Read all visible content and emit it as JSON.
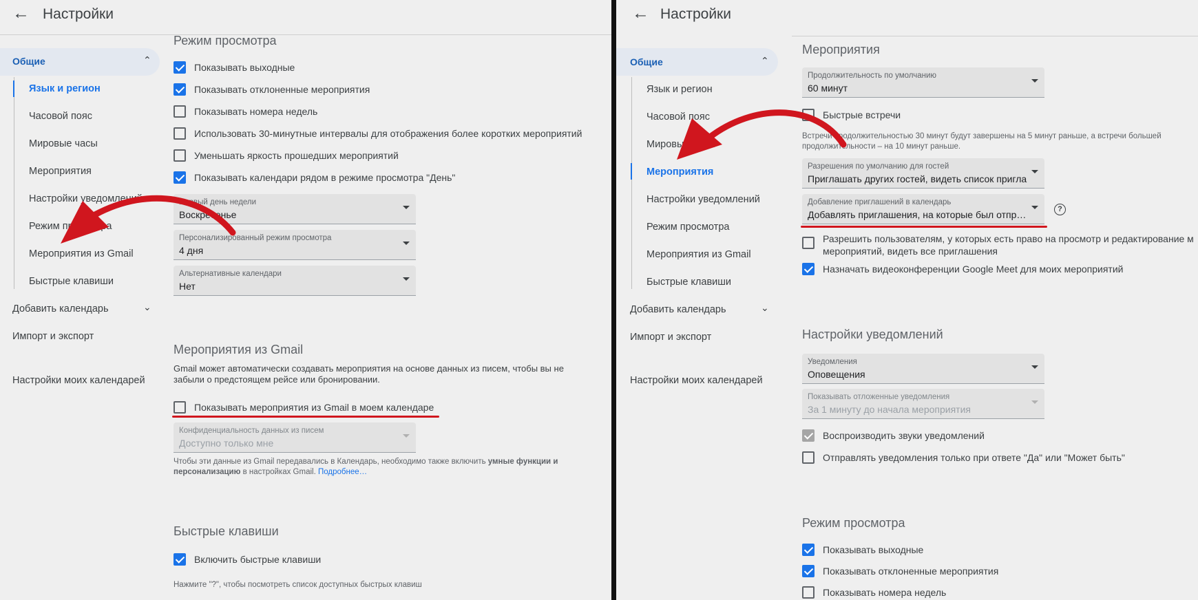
{
  "left": {
    "title": "Настройки",
    "nav": {
      "general": "Общие",
      "items": [
        "Язык и регион",
        "Часовой пояс",
        "Мировые часы",
        "Мероприятия",
        "Настройки уведомлений",
        "Режим просмотра",
        "Мероприятия из Gmail",
        "Быстрые клавиши"
      ],
      "add_calendar": "Добавить календарь",
      "import_export": "Импорт и экспорт",
      "my_calendars": "Настройки моих календарей"
    },
    "view": {
      "title": "Режим просмотра",
      "checks": [
        {
          "label": "Показывать выходные",
          "checked": true
        },
        {
          "label": "Показывать отклоненные мероприятия",
          "checked": true
        },
        {
          "label": "Показывать номера недель",
          "checked": false
        },
        {
          "label": "Использовать 30-минутные интервалы для отображения более коротких мероприятий",
          "checked": false
        },
        {
          "label": "Уменьшать яркость прошедших мероприятий",
          "checked": false
        },
        {
          "label": "Показывать календари рядом в режиме просмотра \"День\"",
          "checked": true
        }
      ],
      "selects": [
        {
          "label": "Первый день недели",
          "value": "Воскресенье"
        },
        {
          "label": "Персонализированный режим просмотра",
          "value": "4 дня"
        },
        {
          "label": "Альтернативные календари",
          "value": "Нет"
        }
      ]
    },
    "gmail": {
      "title": "Мероприятия из Gmail",
      "desc": "Gmail может автоматически создавать мероприятия на основе данных из писем, чтобы вы не забыли о предстоящем рейсе или бронировании.",
      "check": "Показывать мероприятия из Gmail в моем календаре",
      "privacy_label": "Конфиденциальность данных из писем",
      "privacy_value": "Доступно только мне",
      "note_1": "Чтобы эти данные из Gmail передавались в Календарь, необходимо также включить ",
      "note_bold_1": "умные функции и персонализацию",
      "note_2": " в настройках Gmail. ",
      "note_link": "Подробнее…"
    },
    "shortcuts": {
      "title": "Быстрые клавиши",
      "check": "Включить быстрые клавиши",
      "hint": "Нажмите \"?\", чтобы посмотреть список доступных быстрых клавиш"
    }
  },
  "right": {
    "title": "Настройки",
    "nav": {
      "general": "Общие",
      "items": [
        "Язык и регион",
        "Часовой пояс",
        "Мировые часы",
        "Мероприятия",
        "Настройки уведомлений",
        "Режим просмотра",
        "Мероприятия из Gmail",
        "Быстрые клавиши"
      ],
      "add_calendar": "Добавить календарь",
      "import_export": "Импорт и экспорт",
      "my_calendars": "Настройки моих календарей"
    },
    "events": {
      "title": "Мероприятия",
      "duration_label": "Продолжительность по умолчанию",
      "duration_value": "60 минут",
      "quick_meetings": "Быстрые встречи",
      "quick_note": "Встречи продолжительностью 30 минут будут завершены на 5 минут раньше, а встречи большей продолжительности – на 10 минут раньше.",
      "guest_label": "Разрешения по умолчанию для гостей",
      "guest_value": "Приглашать других гостей, видеть список пригла",
      "invite_label": "Добавление приглашений в календарь",
      "invite_value": "Добавлять приглашения, на которые был отпр…",
      "allow_label": "Разрешить пользователям, у которых есть право на просмотр и редактирование м мероприятий, видеть все приглашения",
      "meet_label": "Назначать видеоконференции Google Meet для моих мероприятий"
    },
    "notifications": {
      "title": "Настройки уведомлений",
      "notif_label": "Уведомления",
      "notif_value": "Оповещения",
      "snooze_label": "Показывать отложенные уведомления",
      "snooze_value": "За 1 минуту до начала мероприятия",
      "sounds": "Воспроизводить звуки уведомлений",
      "only_yes": "Отправлять уведомления только при ответе \"Да\" или \"Может быть\""
    },
    "view": {
      "title": "Режим просмотра",
      "checks": [
        "Показывать выходные",
        "Показывать отклоненные мероприятия",
        "Показывать номера недель"
      ]
    }
  },
  "colors": {
    "accent": "#1a73e8",
    "arrow": "#d0161e",
    "background": "#efefef"
  }
}
